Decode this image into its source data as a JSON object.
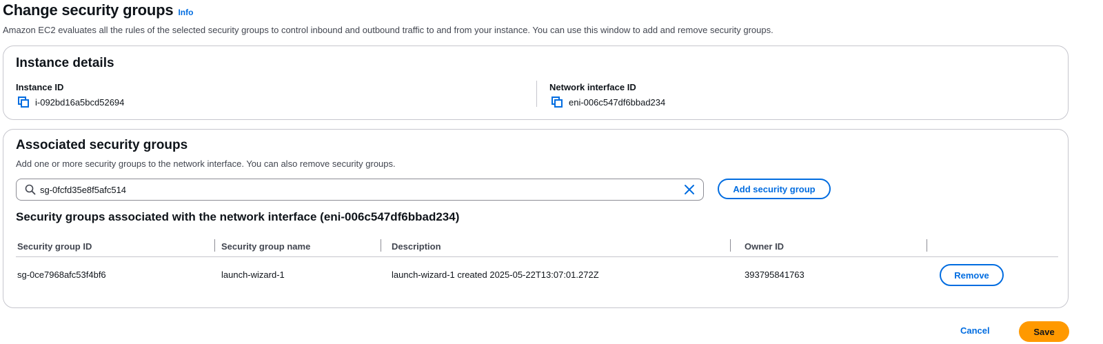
{
  "header": {
    "title": "Change security groups",
    "info_link": "Info",
    "description": "Amazon EC2 evaluates all the rules of the selected security groups to control inbound and outbound traffic to and from your instance. You can use this window to add and remove security groups."
  },
  "instance_details": {
    "title": "Instance details",
    "instance_id_label": "Instance ID",
    "instance_id": "i-092bd16a5bcd52694",
    "network_interface_label": "Network interface ID",
    "network_interface_id": "eni-006c547df6bbad234"
  },
  "associated": {
    "title": "Associated security groups",
    "description": "Add one or more security groups to the network interface. You can also remove security groups.",
    "search_value": "sg-0fcfd35e8f5afc514",
    "add_button": "Add security group",
    "table_title": "Security groups associated with the network interface (eni-006c547df6bbad234)",
    "columns": [
      "Security group ID",
      "Security group name",
      "Description",
      "Owner ID"
    ],
    "rows": [
      {
        "sg_id": "sg-0ce7968afc53f4bf6",
        "sg_name": "launch-wizard-1",
        "description": "launch-wizard-1 created 2025-05-22T13:07:01.272Z",
        "owner_id": "393795841763",
        "remove_label": "Remove"
      }
    ]
  },
  "footer": {
    "cancel": "Cancel",
    "save": "Save"
  },
  "colors": {
    "link_blue": "#006ce0",
    "primary_orange": "#ff9900",
    "border": "#c6c6cd"
  },
  "icons": [
    "copy-icon",
    "search-icon",
    "clear-icon"
  ]
}
